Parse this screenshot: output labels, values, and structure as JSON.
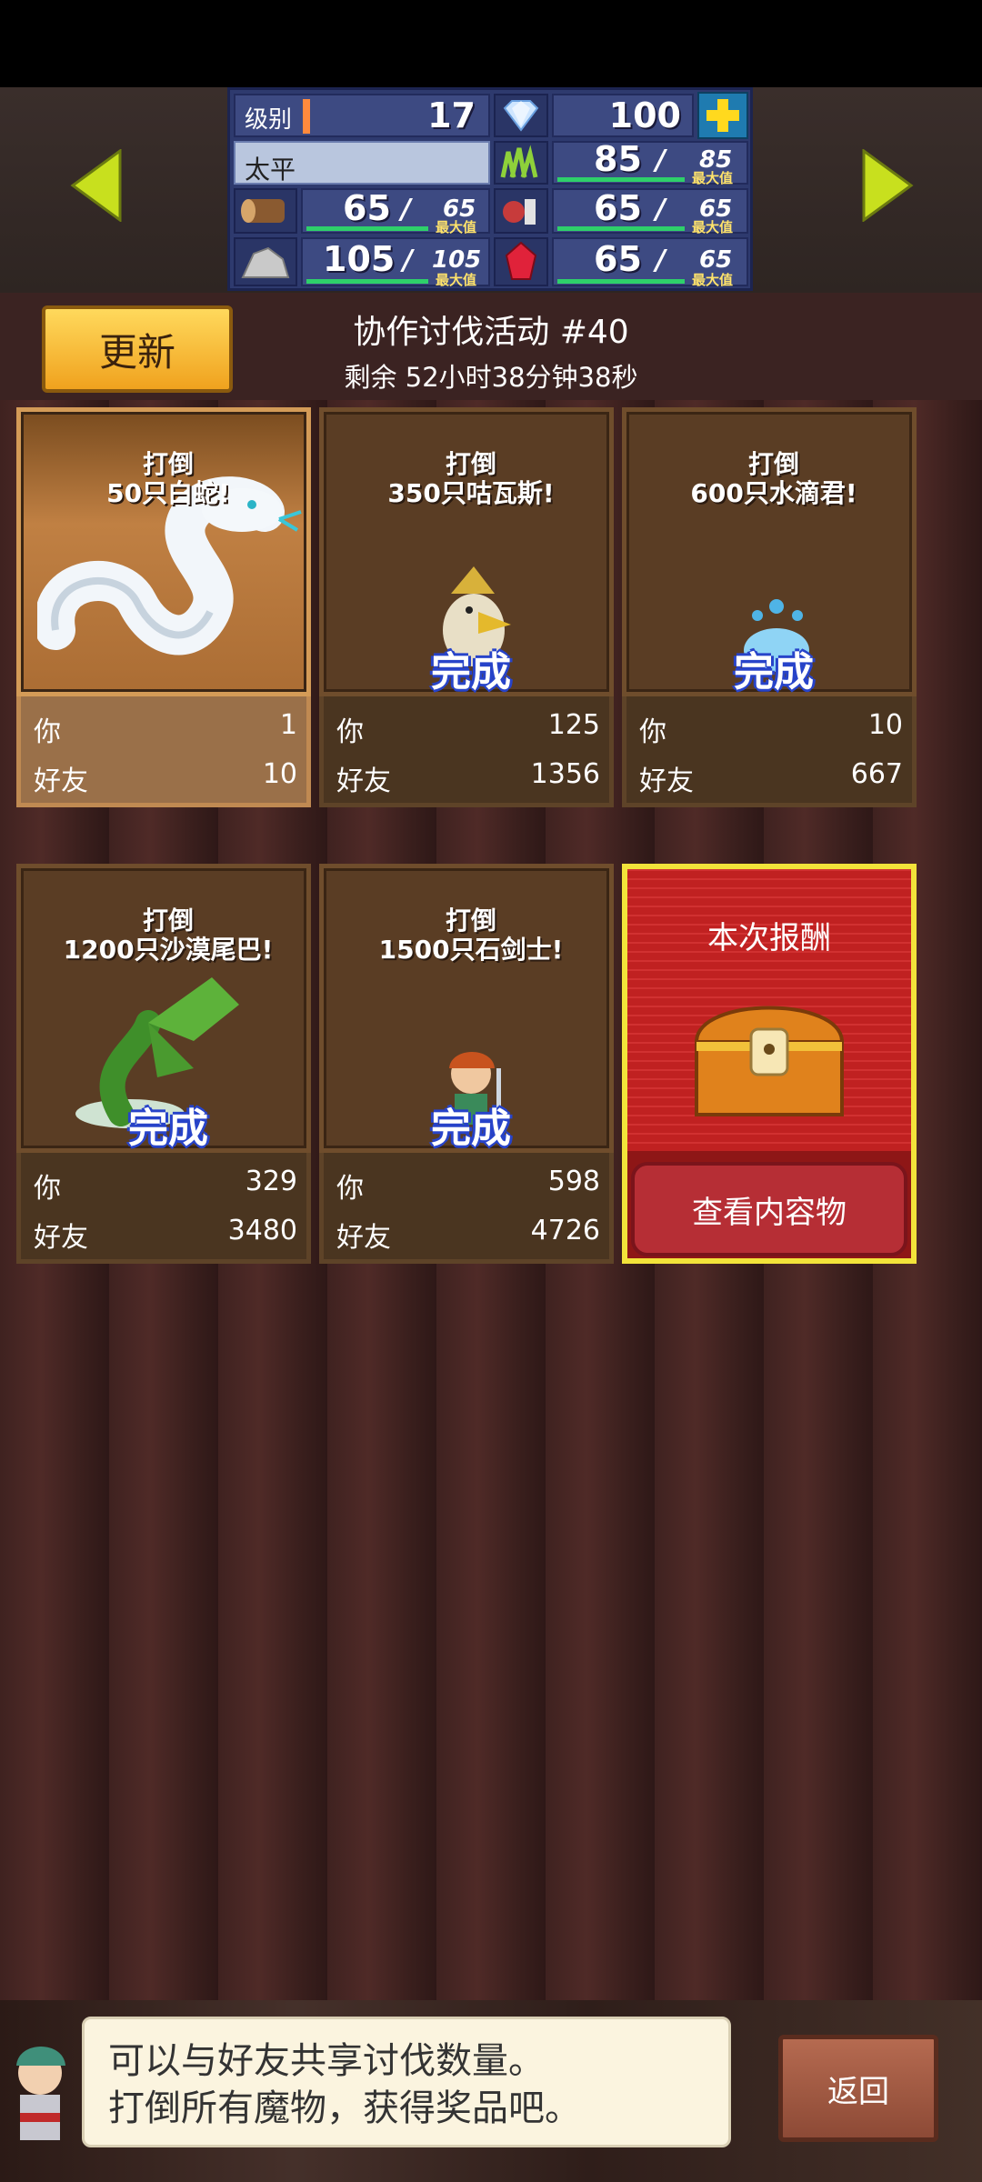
{
  "header": {
    "level_label": "级别",
    "level": "17",
    "gems": "100",
    "player_name": "太平",
    "max_label": "最大值",
    "resources": [
      {
        "name": "grass",
        "value": "85",
        "max": "85"
      },
      {
        "name": "wood",
        "value": "65",
        "max": "65"
      },
      {
        "name": "food",
        "value": "65",
        "max": "65"
      },
      {
        "name": "ore",
        "value": "105",
        "max": "105"
      },
      {
        "name": "ruby",
        "value": "65",
        "max": "65"
      }
    ]
  },
  "event": {
    "update_label": "更新",
    "title": "协作讨伐活动 #40",
    "remaining": "剩余 52小时38分钟38秒"
  },
  "missions": [
    {
      "target_line1": "打倒",
      "target_line2": "50只白蛇!",
      "done": "",
      "you_label": "你",
      "you": "1",
      "friend_label": "好友",
      "friend": "10"
    },
    {
      "target_line1": "打倒",
      "target_line2": "350只咕瓦斯!",
      "done": "完成",
      "you_label": "你",
      "you": "125",
      "friend_label": "好友",
      "friend": "1356"
    },
    {
      "target_line1": "打倒",
      "target_line2": "600只水滴君!",
      "done": "完成",
      "you_label": "你",
      "you": "10",
      "friend_label": "好友",
      "friend": "667"
    },
    {
      "target_line1": "打倒",
      "target_line2": "1200只沙漠尾巴!",
      "done": "完成",
      "you_label": "你",
      "you": "329",
      "friend_label": "好友",
      "friend": "3480"
    },
    {
      "target_line1": "打倒",
      "target_line2": "1500只石剑士!",
      "done": "完成",
      "you_label": "你",
      "you": "598",
      "friend_label": "好友",
      "friend": "4726"
    }
  ],
  "reward": {
    "title": "本次报酬",
    "button": "查看内容物"
  },
  "hint": {
    "line1": "可以与好友共享讨伐数量。",
    "line2": "打倒所有魔物，获得奖品吧。"
  },
  "back_label": "返回",
  "colors": {
    "accent": "#f2e33a",
    "done_outline": "#2743c9",
    "bar": "#2ed06a"
  }
}
